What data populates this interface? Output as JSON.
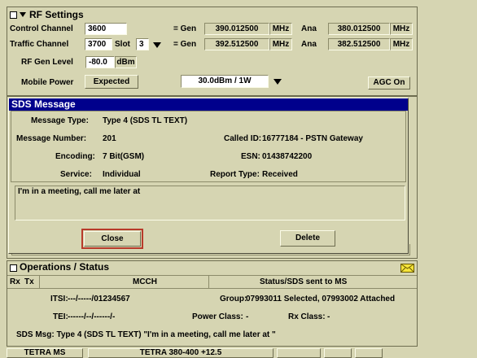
{
  "rf": {
    "title": "RF Settings",
    "control_channel_label": "Control Channel",
    "control_channel_value": "3600",
    "gen1_label": "= Gen",
    "gen1_value": "390.012500",
    "mhz": "MHz",
    "ana": "Ana",
    "ana1_value": "380.012500",
    "traffic_channel_label": "Traffic Channel",
    "traffic_channel_value": "3700",
    "slot_label": "Slot",
    "slot_value": "3",
    "gen2_label": "= Gen",
    "gen2_value": "392.512500",
    "ana2_value": "382.512500",
    "rf_gen_level_label": "RF Gen Level",
    "rf_gen_level_value": "-80.0",
    "dbm": "dBm",
    "mobile_power_label": "Mobile Power",
    "expected_button": "Expected",
    "power_value": "30.0dBm /  1W",
    "agc_button": "AGC On"
  },
  "dialog": {
    "title": "SDS Message",
    "message_type_label": "Message Type:",
    "message_type_value": "Type 4 (SDS TL TEXT)",
    "message_number_label": "Message Number:",
    "message_number_value": "201",
    "called_id_label": "Called ID:",
    "called_id_value": "16777184 - PSTN Gateway",
    "encoding_label": "Encoding:",
    "encoding_value": "7 Bit(GSM)",
    "esn_label": "ESN:",
    "esn_value": "01438742200",
    "service_label": "Service:",
    "service_value": "Individual",
    "report_type_label": "Report Type:",
    "report_type_value": "Received",
    "message_text": "I'm in a meeting, call me later at",
    "close_button": "Close",
    "delete_button": "Delete"
  },
  "ops": {
    "title": "Operations / Status",
    "rx": "Rx",
    "tx": "Tx",
    "mcch": "MCCH",
    "status": "Status/SDS sent to MS",
    "itsi_label": "ITSI:",
    "itsi_value": "---/-----/01234567",
    "group_label": "Group:",
    "group_value": "07993011 Selected, 07993002 Attached",
    "tei_label": "TEI:",
    "tei_value": "------/--/------/-",
    "power_class_label": "Power Class:",
    "power_class_value": "-",
    "rx_class_label": "Rx Class:",
    "rx_class_value": "-",
    "sds_msg": "SDS Msg: Type 4 (SDS TL TEXT) \"I'm in a meeting, call me later at \""
  },
  "statusbar": {
    "mode": "TETRA MS",
    "band": "TETRA 380-400 +12.5"
  }
}
